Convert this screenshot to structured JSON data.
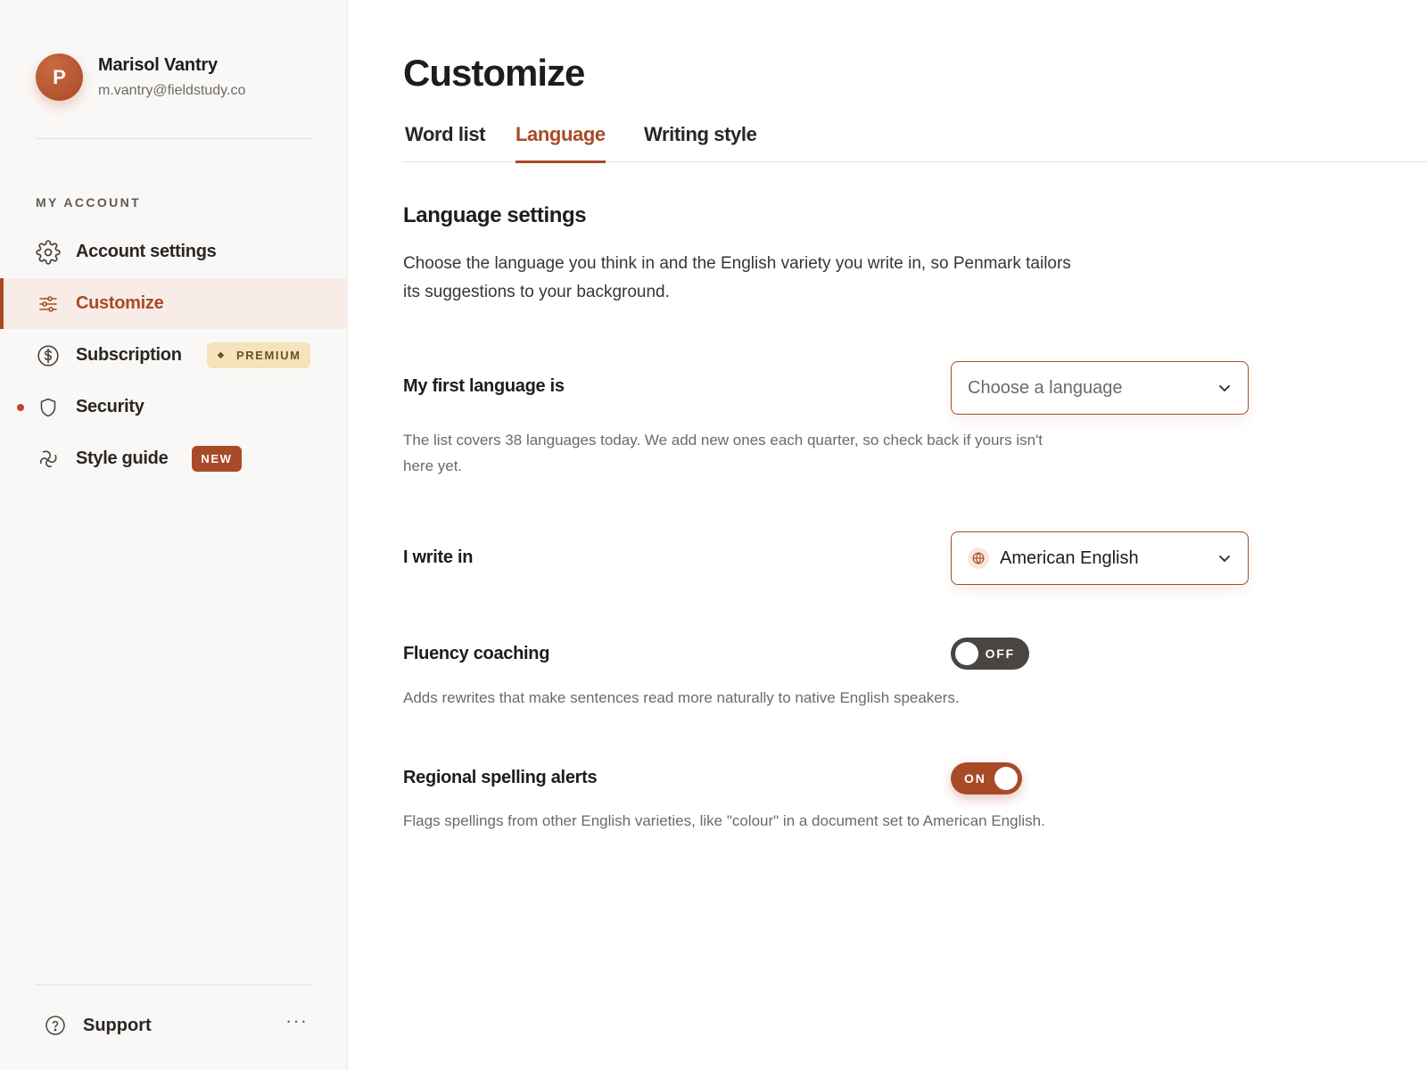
{
  "user": {
    "initial": "P",
    "name": "Marisol Vantry",
    "email": "m.vantry@fieldstudy.co"
  },
  "sidebar": {
    "section_label": "MY ACCOUNT",
    "items": [
      {
        "label": "Account settings",
        "icon": "gear-icon"
      },
      {
        "label": "Customize",
        "icon": "sliders-icon",
        "active": true
      },
      {
        "label": "Subscription",
        "icon": "dollar-circle-icon",
        "badge": "PREMIUM"
      },
      {
        "label": "Security",
        "icon": "shield-icon",
        "alert": true
      },
      {
        "label": "Style guide",
        "icon": "style-icon",
        "badge": "NEW"
      }
    ],
    "support_label": "Support",
    "more_label": "···"
  },
  "page": {
    "title": "Customize",
    "tabs": [
      {
        "label": "Word list"
      },
      {
        "label": "Language",
        "active": true
      },
      {
        "label": "Writing style"
      }
    ]
  },
  "language_settings": {
    "title": "Language settings",
    "description": "Choose the language you think in and the English variety you write in, so Penmark tailors its suggestions to your background.",
    "first_language": {
      "label": "My first language is",
      "placeholder": "Choose a language",
      "help": "The list covers 38 languages today. We add new ones each quarter, so check back if yours isn't here yet."
    },
    "write_in": {
      "label": "I write in",
      "value": "American English"
    },
    "fluency": {
      "label": "Fluency coaching",
      "state": "OFF",
      "help": "Adds rewrites that make sentences read more naturally to native English speakers."
    },
    "regional": {
      "label": "Regional spelling alerts",
      "state": "ON",
      "help": "Flags spellings from other English varieties, like \"colour\" in a document set to American English."
    }
  },
  "colors": {
    "accent": "#a94a27",
    "premium_bg": "#f5e4bb",
    "sidebar_bg": "#faf8f6",
    "toggle_off": "#4a4541"
  }
}
